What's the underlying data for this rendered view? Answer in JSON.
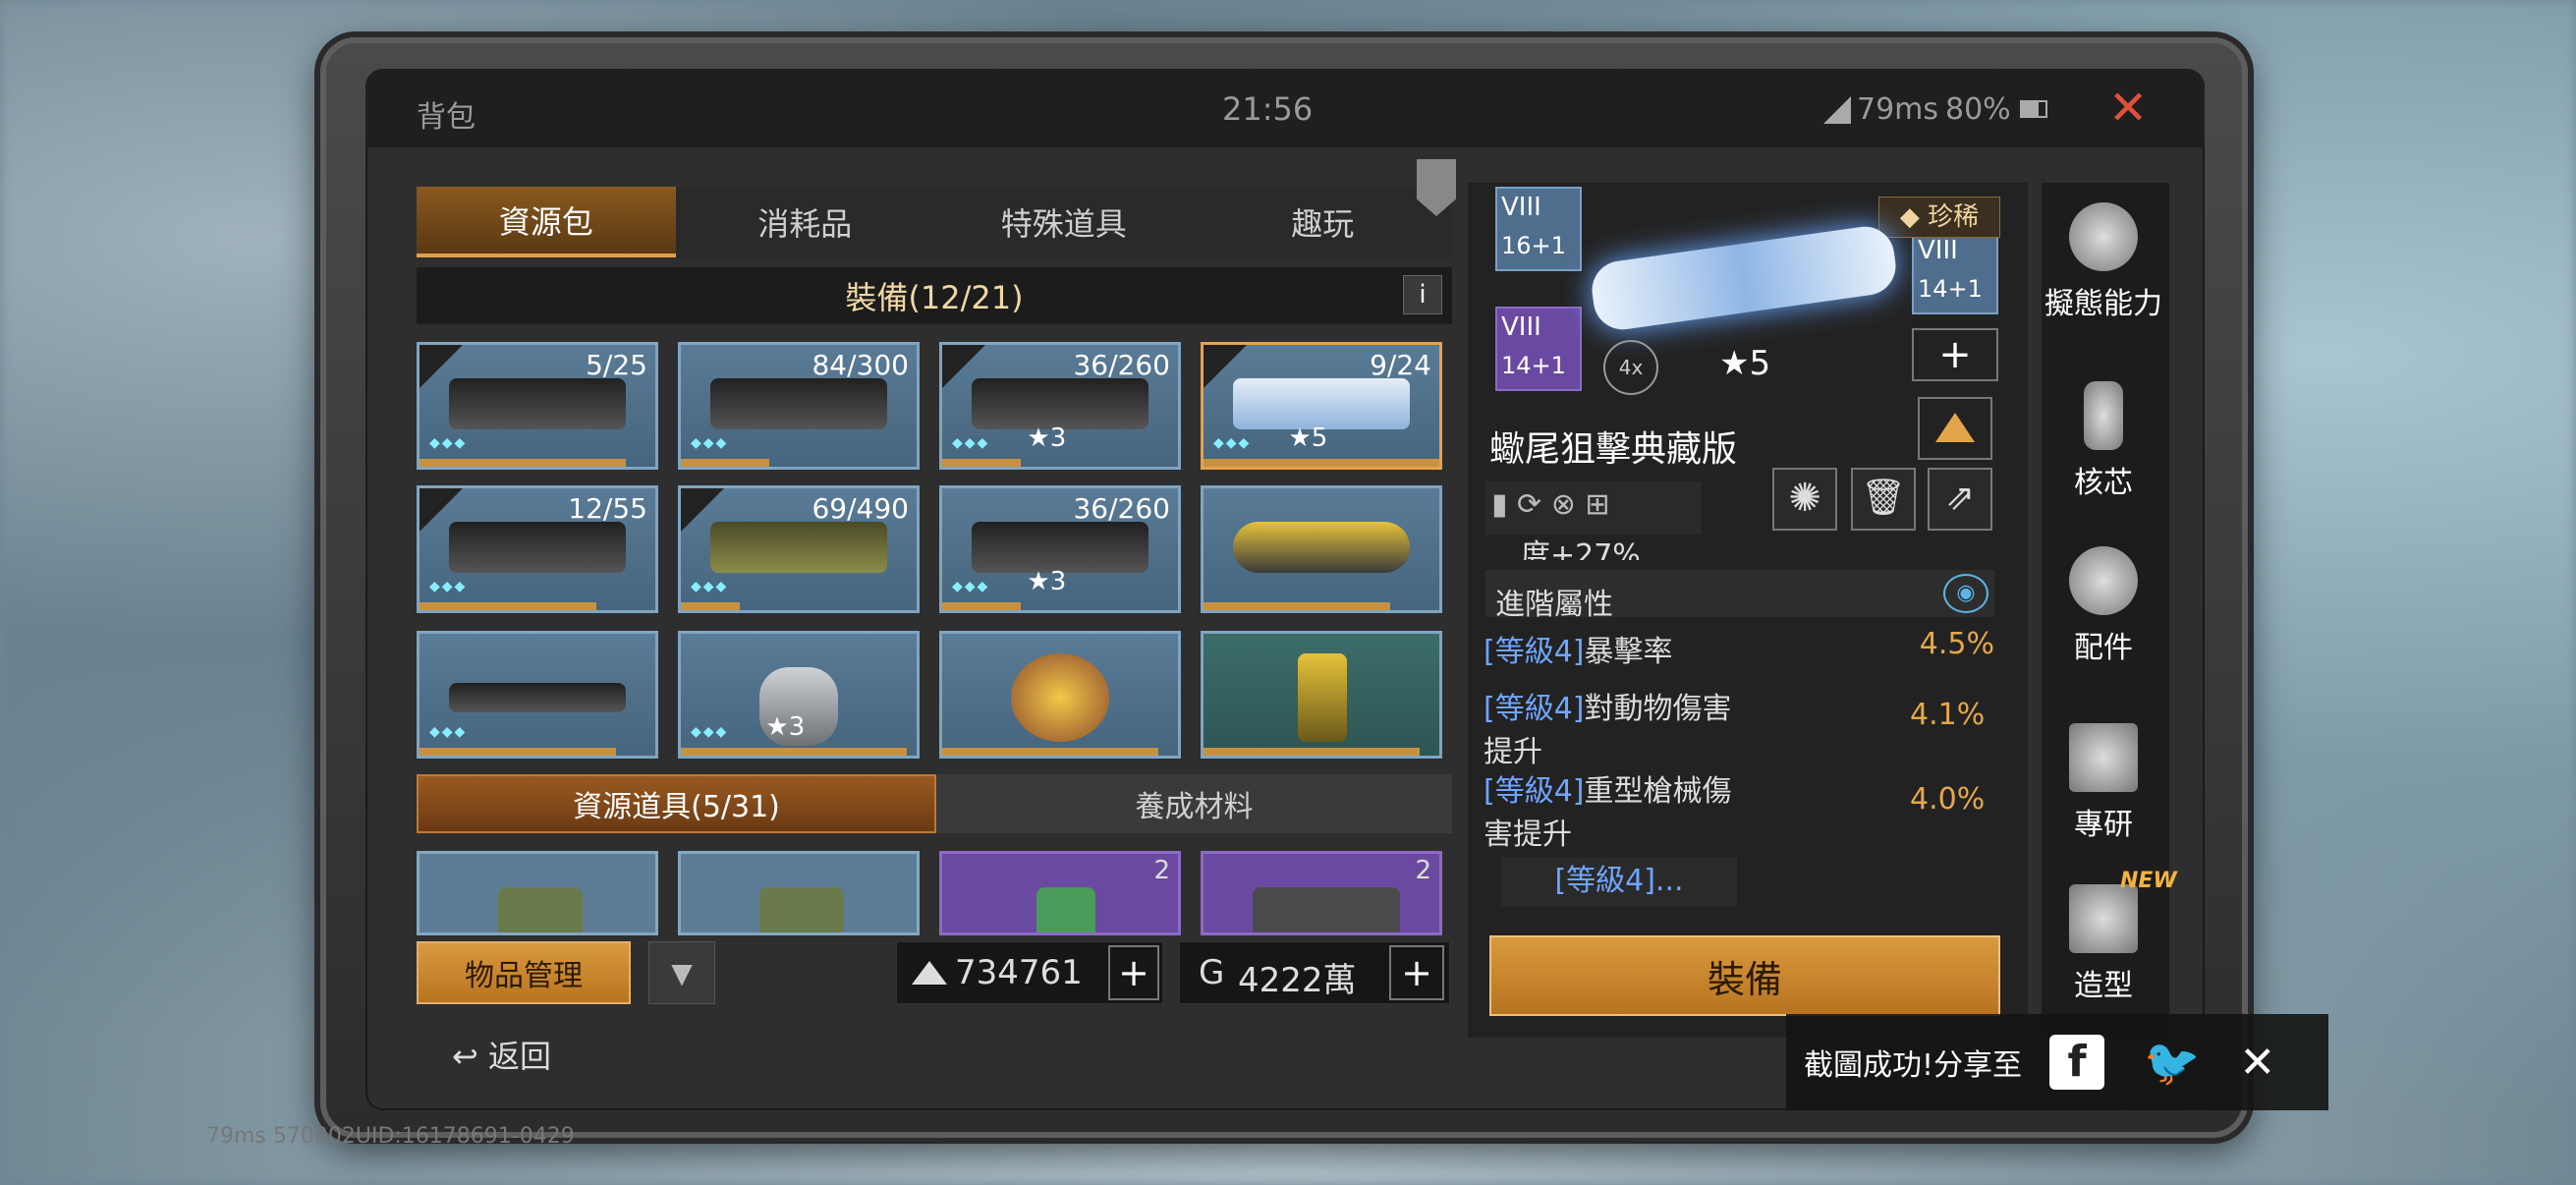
{
  "status": {
    "title": "背包",
    "time": "21:56",
    "ping": "79ms",
    "battery": "80%"
  },
  "tabs": [
    "資源包",
    "消耗品",
    "特殊道具",
    "趣玩"
  ],
  "equip_header": "裝備(12/21)",
  "info": "i",
  "cards": [
    {
      "count": "5/25",
      "level": ""
    },
    {
      "count": "84/300",
      "level": ""
    },
    {
      "count": "36/260",
      "level": "3"
    },
    {
      "count": "9/24",
      "level": "5"
    },
    {
      "count": "12/55",
      "level": ""
    },
    {
      "count": "69/490",
      "level": ""
    },
    {
      "count": "36/260",
      "level": "3"
    },
    {
      "count": "",
      "level": ""
    },
    {
      "count": "",
      "level": ""
    },
    {
      "count": "",
      "level": "3"
    },
    {
      "count": "",
      "level": ""
    },
    {
      "count": "",
      "level": ""
    }
  ],
  "subtabs": [
    "資源道具(5/31)",
    "養成材料"
  ],
  "res_counts": [
    "",
    "",
    "2",
    "2"
  ],
  "manage_label": "物品管理",
  "currency1": "734761",
  "currency2": "4222萬",
  "plus": "+",
  "back_label": "返回",
  "detail": {
    "slot1": {
      "rank": "VIII",
      "level": "16+1"
    },
    "slot2": {
      "rank": "VIII",
      "level": "14+1"
    },
    "slot3": {
      "rank": "VIII",
      "level": "14+1"
    },
    "rarity": "珍稀",
    "scope": "4x",
    "stars": "5",
    "name": "蠍尾狙擊典藏版",
    "cut_text": "度+27%",
    "advanced_label": "進階屬性",
    "attrs": [
      {
        "tag": "[等級4]",
        "name": "暴擊率",
        "value": "4.5%"
      },
      {
        "tag": "[等級4]",
        "name": "對動物傷害提升",
        "value": "4.1%"
      },
      {
        "tag": "[等級4]",
        "name": "重型槍械傷害提升",
        "value": "4.0%"
      }
    ],
    "more": "[等級4]...",
    "equip_button": "裝備"
  },
  "side": [
    "擬態能力",
    "核芯",
    "配件",
    "專研",
    "造型"
  ],
  "side_new": "NEW",
  "toast": "截圖成功!分享至",
  "uid_text": "79ms 570002UID:16178691-0429",
  "colors": {
    "accent": "#d99a3e",
    "attr_tag": "#6fa6ff",
    "attr_value": "#e5a84a"
  }
}
